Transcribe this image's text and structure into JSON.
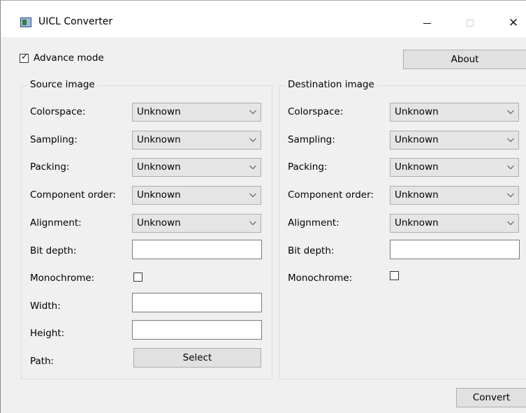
{
  "window": {
    "title": "UICL Converter",
    "controls": {
      "minimize_icon": "minimize-icon",
      "maximize_icon": "maximize-icon",
      "close_icon": "close-icon",
      "close_glyph": "✕"
    }
  },
  "top": {
    "advance_mode": {
      "label": "Advance mode",
      "checked": true
    },
    "about_label": "About"
  },
  "source": {
    "title": "Source image",
    "colorspace": {
      "label": "Colorspace:",
      "value": "Unknown"
    },
    "sampling": {
      "label": "Sampling:",
      "value": "Unknown"
    },
    "packing": {
      "label": "Packing:",
      "value": "Unknown"
    },
    "component_order": {
      "label": "Component order:",
      "value": "Unknown"
    },
    "alignment": {
      "label": "Alignment:",
      "value": "Unknown"
    },
    "bit_depth": {
      "label": "Bit depth:",
      "value": ""
    },
    "monochrome": {
      "label": "Monochrome:",
      "checked": false
    },
    "width": {
      "label": "Width:",
      "value": ""
    },
    "height": {
      "label": "Height:",
      "value": ""
    },
    "path": {
      "label": "Path:",
      "button": "Select"
    }
  },
  "destination": {
    "title": "Destination image",
    "colorspace": {
      "label": "Colorspace:",
      "value": "Unknown"
    },
    "sampling": {
      "label": "Sampling:",
      "value": "Unknown"
    },
    "packing": {
      "label": "Packing:",
      "value": "Unknown"
    },
    "component_order": {
      "label": "Component order:",
      "value": "Unknown"
    },
    "alignment": {
      "label": "Alignment:",
      "value": "Unknown"
    },
    "bit_depth": {
      "label": "Bit depth:",
      "value": ""
    },
    "monochrome": {
      "label": "Monochrome:",
      "checked": false
    }
  },
  "footer": {
    "convert_label": "Convert"
  }
}
